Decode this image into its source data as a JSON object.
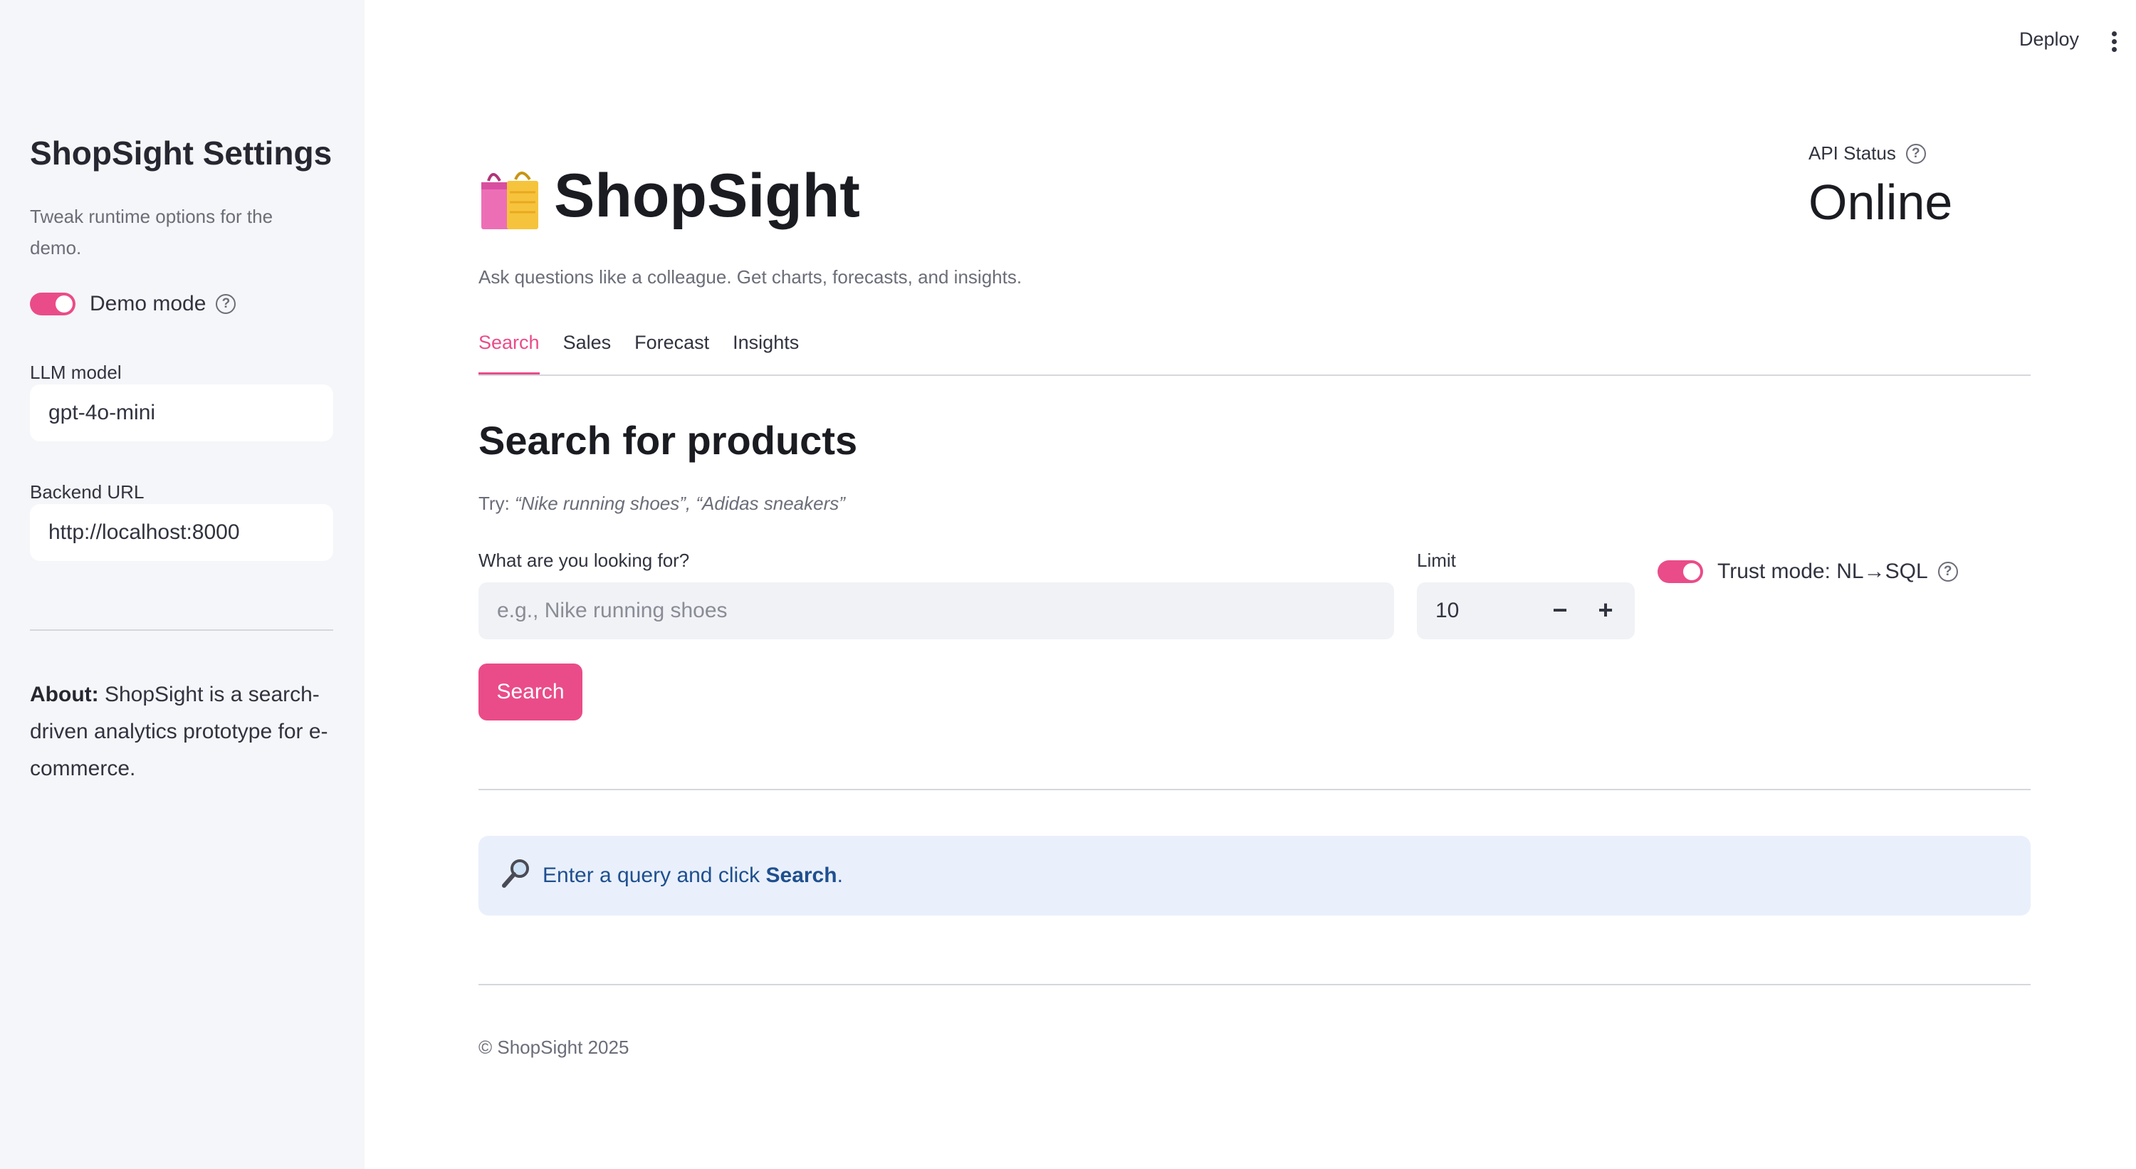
{
  "sidebar": {
    "title": "ShopSight Settings",
    "caption": "Tweak runtime options for the demo.",
    "demo_mode_label": "Demo mode",
    "llm_model_label": "LLM model",
    "llm_model_value": "gpt-4o-mini",
    "backend_url_label": "Backend URL",
    "backend_url_value": "http://localhost:8000",
    "about_bold": "About:",
    "about_text": " ShopSight is a search-driven analytics prototype for e-commerce."
  },
  "toolbar": {
    "deploy_label": "Deploy"
  },
  "header": {
    "title": "ShopSight",
    "subtitle": "Ask questions like a colleague. Get charts, forecasts, and insights.",
    "api_status_label": "API Status",
    "api_status_value": "Online"
  },
  "tabs": [
    {
      "label": "Search"
    },
    {
      "label": "Sales"
    },
    {
      "label": "Forecast"
    },
    {
      "label": "Insights"
    }
  ],
  "search": {
    "section_title": "Search for products",
    "try_prefix": "Try: ",
    "try_examples": "“Nike running shoes”, “Adidas sneakers”",
    "query_label": "What are you looking for?",
    "query_placeholder": "e.g., Nike running shoes",
    "limit_label": "Limit",
    "limit_value": "10",
    "decrement": "−",
    "increment": "+",
    "trust_mode_label": "Trust mode: NL→SQL",
    "search_button": "Search",
    "info_prefix": "Enter a query and click ",
    "info_bold": "Search",
    "info_suffix": "."
  },
  "footer": {
    "text": "© ShopSight 2025"
  },
  "colors": {
    "accent": "#ea4c89",
    "sidebar_bg": "#f5f6f9",
    "info_bg": "#e9f0fb",
    "info_text": "#1f4f8f"
  }
}
